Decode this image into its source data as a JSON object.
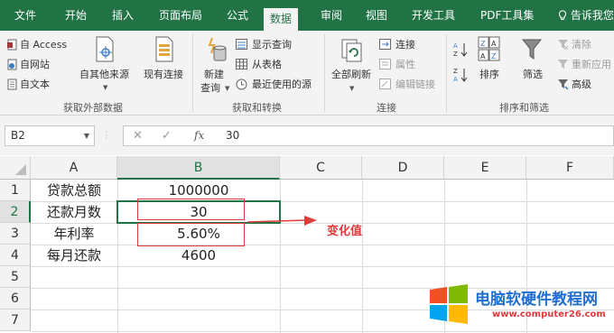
{
  "menu": {
    "tabs": [
      "文件",
      "开始",
      "插入",
      "页面布局",
      "公式",
      "数据",
      "审阅",
      "视图",
      "开发工具",
      "PDF工具集"
    ],
    "active_tab": "数据",
    "tell_me": "告诉我您"
  },
  "ribbon": {
    "get_external": {
      "access": "自 Access",
      "web": "自网站",
      "text": "自文本",
      "other_sources": "自其他来源",
      "existing": "现有连接",
      "label": "获取外部数据"
    },
    "transform": {
      "new_query_line1": "新建",
      "new_query_line2": "查询",
      "show_queries": "显示查询",
      "from_table": "从表格",
      "recent_sources": "最近使用的源",
      "label": "获取和转换"
    },
    "connections": {
      "refresh_all": "全部刷新",
      "connections": "连接",
      "properties": "属性",
      "edit_links": "编辑链接",
      "label": "连接"
    },
    "sort_filter": {
      "sort": "排序",
      "filter": "筛选",
      "clear": "清除",
      "reapply": "重新应用",
      "advanced": "高级",
      "label": "排序和筛选"
    }
  },
  "formula_bar": {
    "name_box": "B2",
    "cancel": "✕",
    "enter": "✓",
    "fx": "fx",
    "value": "30"
  },
  "sheet": {
    "columns": [
      "A",
      "B",
      "C",
      "D",
      "E",
      "F"
    ],
    "rows": [
      "1",
      "2",
      "3",
      "4",
      "5",
      "6",
      "7"
    ],
    "cells": {
      "a1": "贷款总额",
      "b1": "1000000",
      "a2": "还款月数",
      "b2": "30",
      "a3": "年利率",
      "b3": "5.60%",
      "a4": "每月还款",
      "b4": "4600"
    },
    "annotation": "变化值"
  },
  "watermark": {
    "title": "电脑软硬件教程网",
    "url": "www.computer26.com"
  },
  "colors": {
    "excel_green": "#217346",
    "annotation_red": "#e03a3a"
  }
}
